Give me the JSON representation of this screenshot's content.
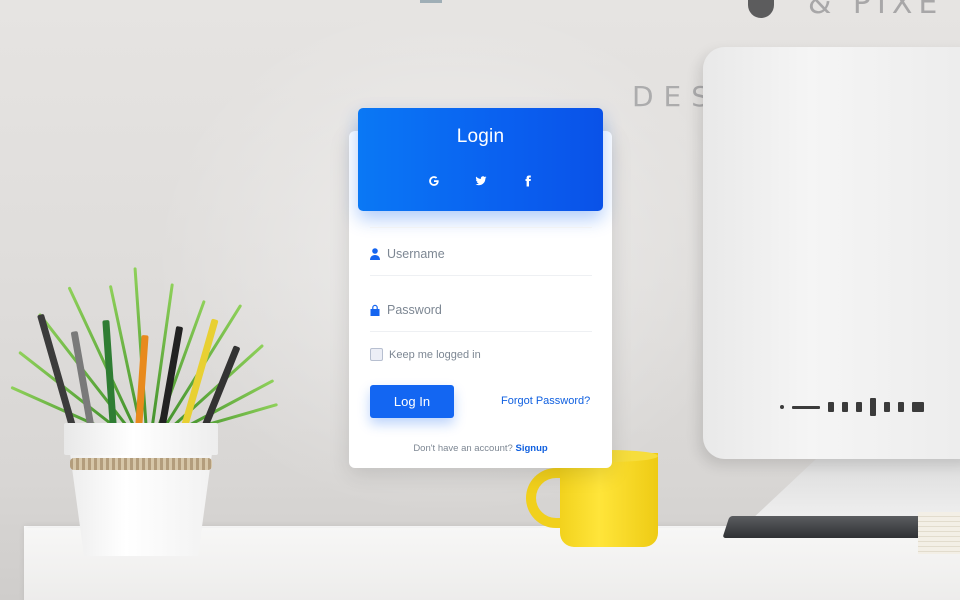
{
  "login": {
    "title": "Login",
    "social": [
      {
        "name": "google-icon",
        "label": "G"
      },
      {
        "name": "twitter-icon",
        "label": "twitter"
      },
      {
        "name": "facebook-icon",
        "label": "f"
      }
    ],
    "username_placeholder": "Username",
    "password_placeholder": "Password",
    "remember_label": "Keep me logged in",
    "login_button": "Log In",
    "forgot_link": "Forgot Password?",
    "signup_prompt": "Don't have an account?",
    "signup_link": "Signup"
  },
  "background": {
    "wall_text": "DES",
    "wall_logo_text": "& PIXE"
  },
  "colors": {
    "accent": "#0a60f0",
    "link": "#1060e0",
    "muted_text": "#7d8793",
    "mug": "#f6dd3c"
  }
}
